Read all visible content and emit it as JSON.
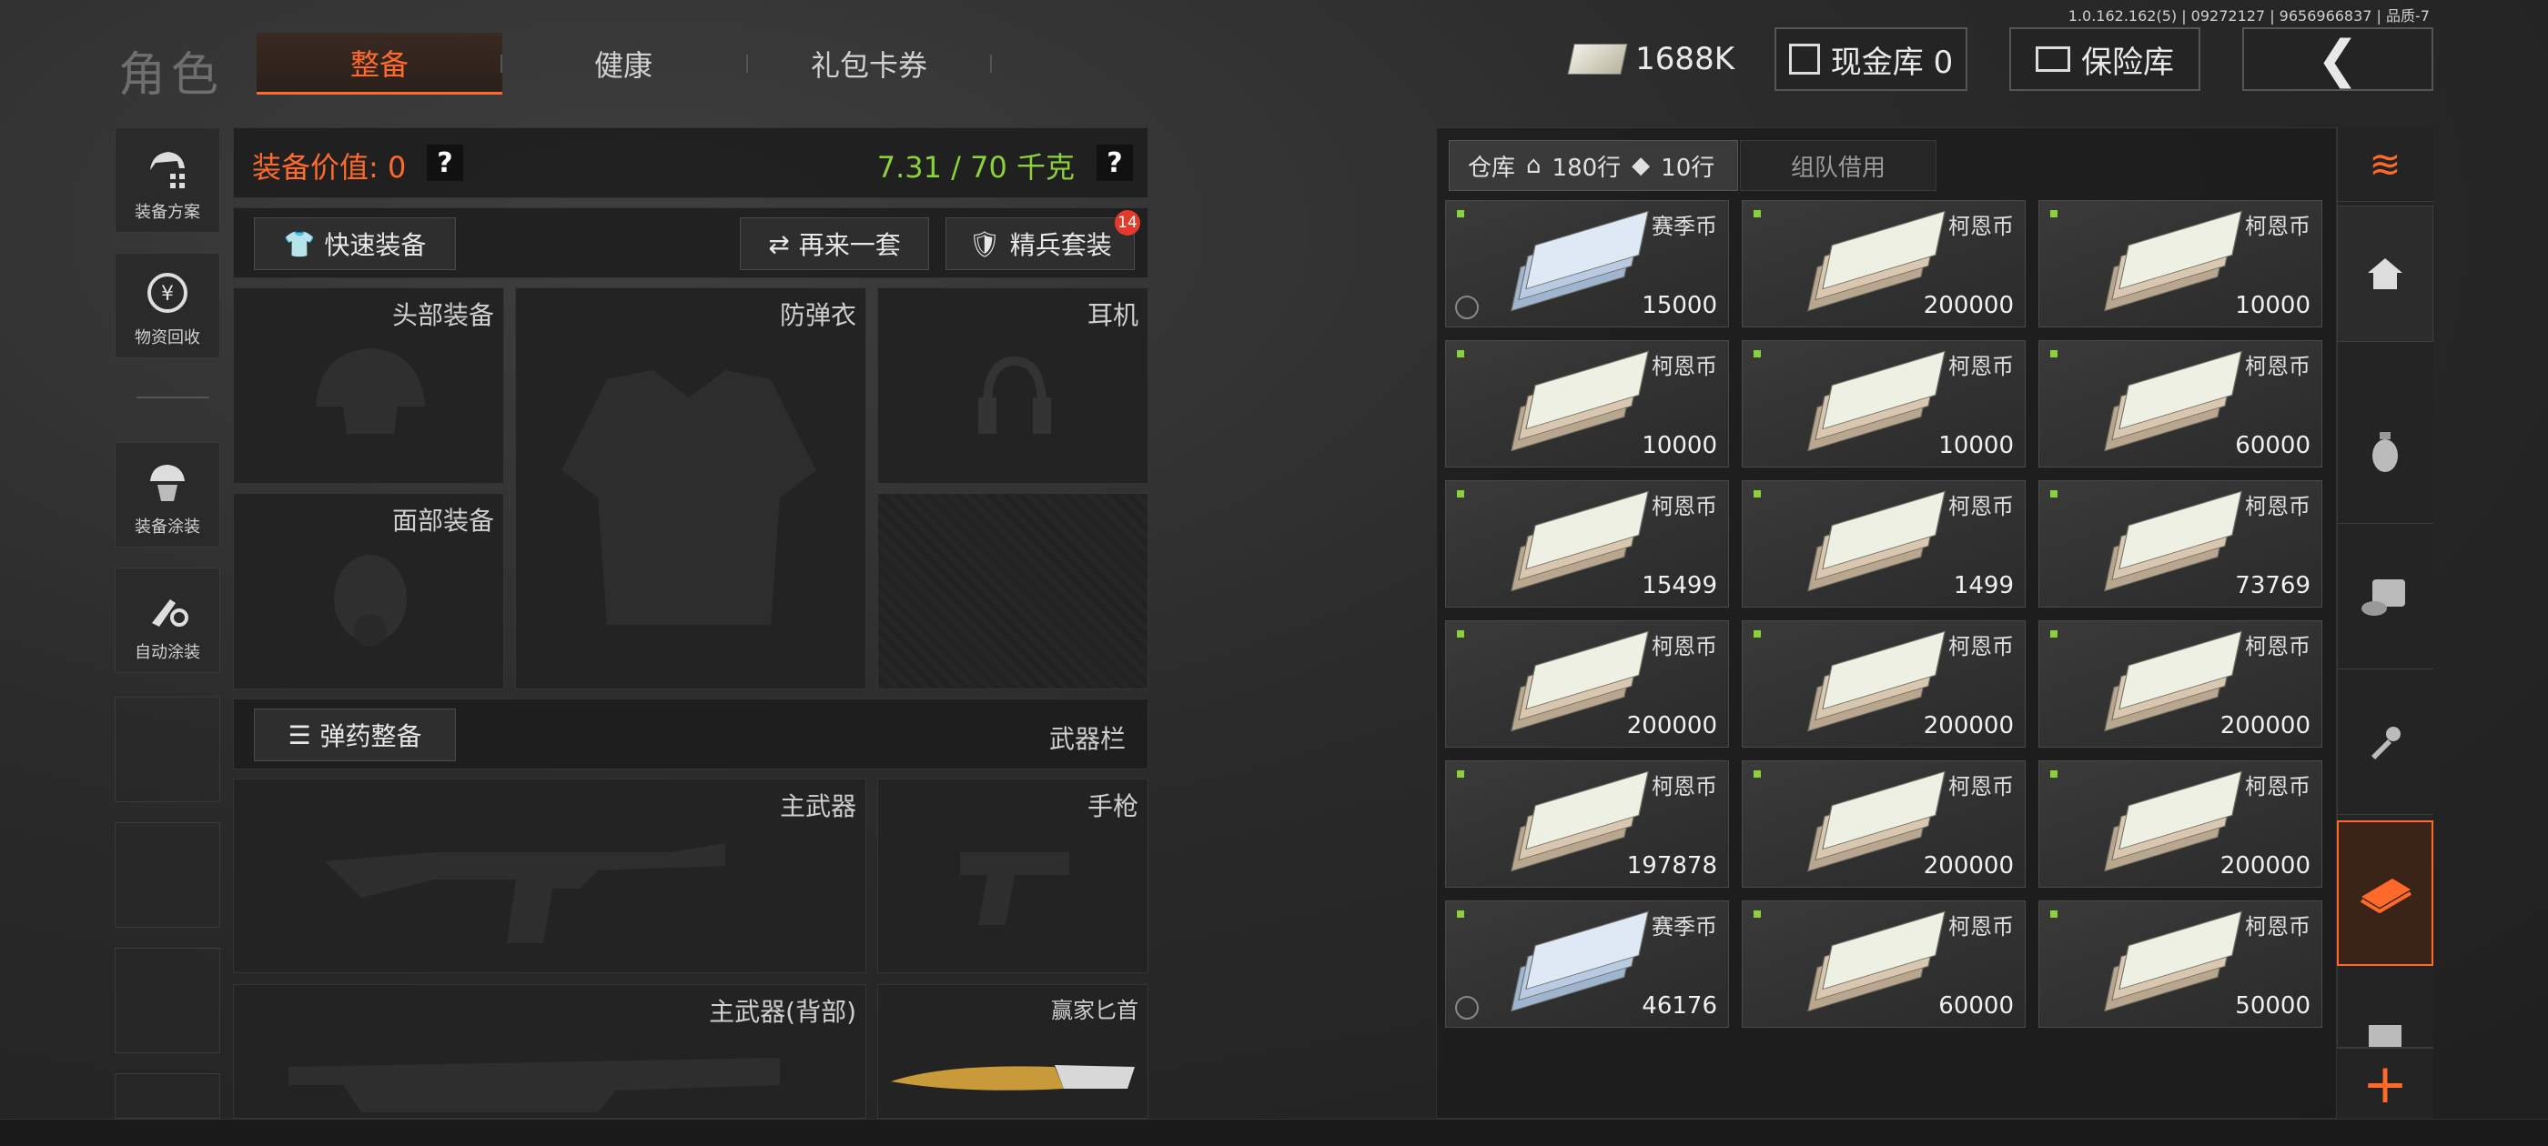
{
  "version": "1.0.162.162(5) | 09272127 | 9656966837 | 品质-7",
  "header": {
    "title": "角色",
    "tabs": [
      {
        "label": "整备",
        "active": true
      },
      {
        "label": "健康",
        "active": false
      },
      {
        "label": "礼包卡券",
        "active": false
      }
    ],
    "money": "1688K",
    "cash_vault": "现金库 0",
    "safe_box": "保险库"
  },
  "left_menu": [
    {
      "label": "装备方案",
      "icon": "loadout-plan-icon"
    },
    {
      "label": "物资回收",
      "icon": "recycle-icon"
    },
    {
      "label": "装备涂装",
      "icon": "skin-icon"
    },
    {
      "label": "自动涂装",
      "icon": "auto-paint-icon"
    }
  ],
  "equipment": {
    "value_label": "装备价值: 0",
    "help": "?",
    "weight": "7.31 / 70 千克",
    "quick_equip": "快速装备",
    "redo_set": "再来一套",
    "elite_set": "精兵套装",
    "elite_badge": "14",
    "slots": {
      "head": "头部装备",
      "armor": "防弹衣",
      "headset": "耳机",
      "face": "面部装备"
    },
    "ammo_button": "弹药整备",
    "weapon_bar": "武器栏",
    "primary": "主武器",
    "pistol": "手枪",
    "primary_back": "主武器(背部)",
    "knife": "赢家匕首"
  },
  "inventory": {
    "tabs": [
      {
        "label": "仓库",
        "rows": "180行",
        "rows2": "10行",
        "active": true
      },
      {
        "label": "组队借用",
        "active": false
      }
    ],
    "items": [
      {
        "name": "赛季币",
        "qty": "15000",
        "type": "season"
      },
      {
        "name": "柯恩币",
        "qty": "200000",
        "type": "koen"
      },
      {
        "name": "柯恩币",
        "qty": "10000",
        "type": "koen"
      },
      {
        "name": "柯恩币",
        "qty": "10000",
        "type": "koen"
      },
      {
        "name": "柯恩币",
        "qty": "10000",
        "type": "koen"
      },
      {
        "name": "柯恩币",
        "qty": "60000",
        "type": "koen"
      },
      {
        "name": "柯恩币",
        "qty": "15499",
        "type": "koen"
      },
      {
        "name": "柯恩币",
        "qty": "1499",
        "type": "koen"
      },
      {
        "name": "柯恩币",
        "qty": "73769",
        "type": "koen"
      },
      {
        "name": "柯恩币",
        "qty": "200000",
        "type": "koen"
      },
      {
        "name": "柯恩币",
        "qty": "200000",
        "type": "koen"
      },
      {
        "name": "柯恩币",
        "qty": "200000",
        "type": "koen"
      },
      {
        "name": "柯恩币",
        "qty": "197878",
        "type": "koen"
      },
      {
        "name": "柯恩币",
        "qty": "200000",
        "type": "koen"
      },
      {
        "name": "柯恩币",
        "qty": "200000",
        "type": "koen"
      },
      {
        "name": "赛季币",
        "qty": "46176",
        "type": "season"
      },
      {
        "name": "柯恩币",
        "qty": "60000",
        "type": "koen"
      },
      {
        "name": "柯恩币",
        "qty": "50000",
        "type": "koen"
      }
    ]
  },
  "side_tabs": [
    "all-items-icon",
    "home-icon",
    "grenade-icon",
    "consumable-icon",
    "key-icon",
    "currency-icon",
    "crate-icon"
  ],
  "colors": {
    "accent": "#ff6a2a",
    "weight_ok": "#8ad13a"
  }
}
